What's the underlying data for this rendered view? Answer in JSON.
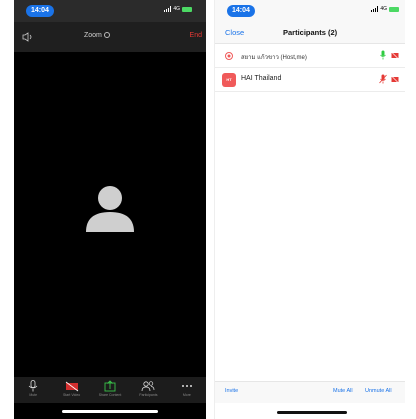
{
  "left": {
    "status_bar": {
      "time": "14:04",
      "network": "4G"
    },
    "top_bar": {
      "title": "Zoom",
      "end_label": "End"
    },
    "toolbar": {
      "items": [
        {
          "label": "Mute",
          "icon": "microphone-icon"
        },
        {
          "label": "Start Video",
          "icon": "video-off-icon"
        },
        {
          "label": "Share Content",
          "icon": "share-icon"
        },
        {
          "label": "Participants",
          "icon": "participants-icon"
        },
        {
          "label": "More",
          "icon": "more-icon"
        }
      ]
    }
  },
  "right": {
    "status_bar": {
      "time": "14:04",
      "network": "4G"
    },
    "nav": {
      "close_label": "Close",
      "title": "Participants (2)"
    },
    "participants": [
      {
        "name": "สยาม แก้วขาว (Host,me)",
        "avatar": "",
        "mic": "unmuted",
        "video": "off"
      },
      {
        "name": "HAI Thailand",
        "avatar": "HT",
        "mic": "muted",
        "video": "off"
      }
    ],
    "bottom": {
      "invite_label": "Invite",
      "mute_all_label": "Mute All",
      "unmute_all_label": "Unmute All"
    }
  },
  "colors": {
    "accent": "#1a73e8",
    "end_red": "#e53935",
    "mic_green": "#2ecc40",
    "avatar_red": "#f05a5a"
  }
}
